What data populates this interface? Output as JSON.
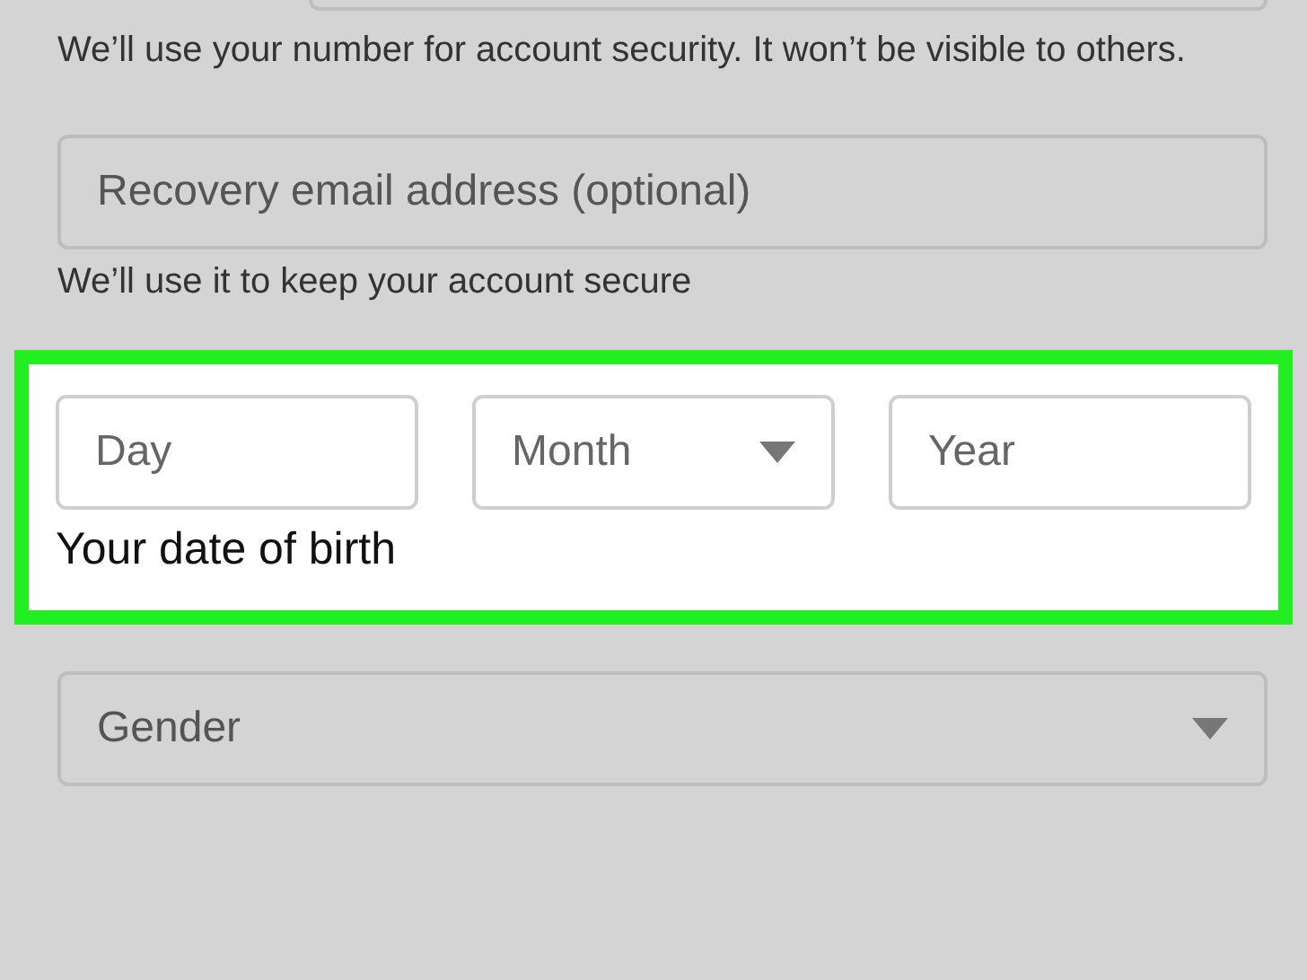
{
  "phone_field": {
    "kind": "text"
  },
  "phone_hint": "We’ll use your number for account security. It won’t be visible to others.",
  "recovery_email": {
    "placeholder": "Recovery email address (optional)"
  },
  "recovery_hint": "We’ll use it to keep your account secure",
  "birthdate": {
    "highlighted": true,
    "fields": [
      {
        "kind": "text",
        "placeholder": "Day"
      },
      {
        "kind": "select",
        "placeholder": "Month"
      },
      {
        "kind": "text",
        "placeholder": "Year"
      }
    ],
    "label": "Your date of birth"
  },
  "gender": {
    "kind": "select",
    "placeholder": "Gender"
  }
}
